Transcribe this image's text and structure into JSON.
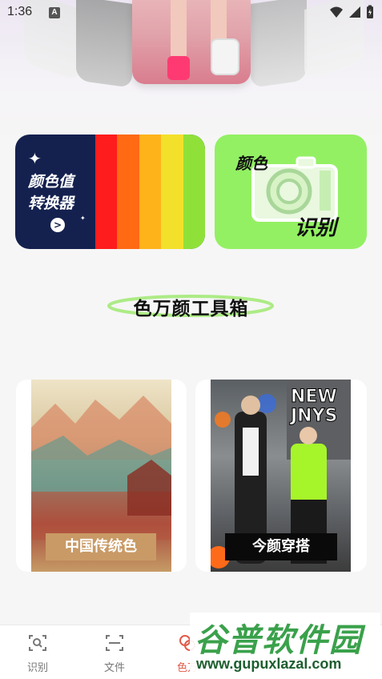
{
  "status_bar": {
    "time": "1:36",
    "notification_badge": "A"
  },
  "banner": {
    "description_icons": [
      "photo"
    ]
  },
  "feature_cards": {
    "converter": {
      "title_line1": "颜色值",
      "title_line2": "转换器",
      "go_symbol": ">"
    },
    "recognition": {
      "title_top": "颜色",
      "title_bottom": "识别"
    }
  },
  "section": {
    "title": "色万颜工具箱"
  },
  "tools": [
    {
      "label": "中国传统色"
    },
    {
      "label": "今颜穿搭"
    }
  ],
  "bottom_nav": {
    "items": [
      {
        "label": "识别",
        "icon": "scan-search-icon"
      },
      {
        "label": "文件",
        "icon": "scan-frame-icon"
      },
      {
        "label": "色万",
        "icon": "palette-icon"
      }
    ]
  },
  "watermark": {
    "title": "谷普软件园",
    "url": "www.gupuxlazal.com"
  },
  "colors": {
    "accent": "#e25a49",
    "navy": "#14214f",
    "green": "#93f063"
  }
}
